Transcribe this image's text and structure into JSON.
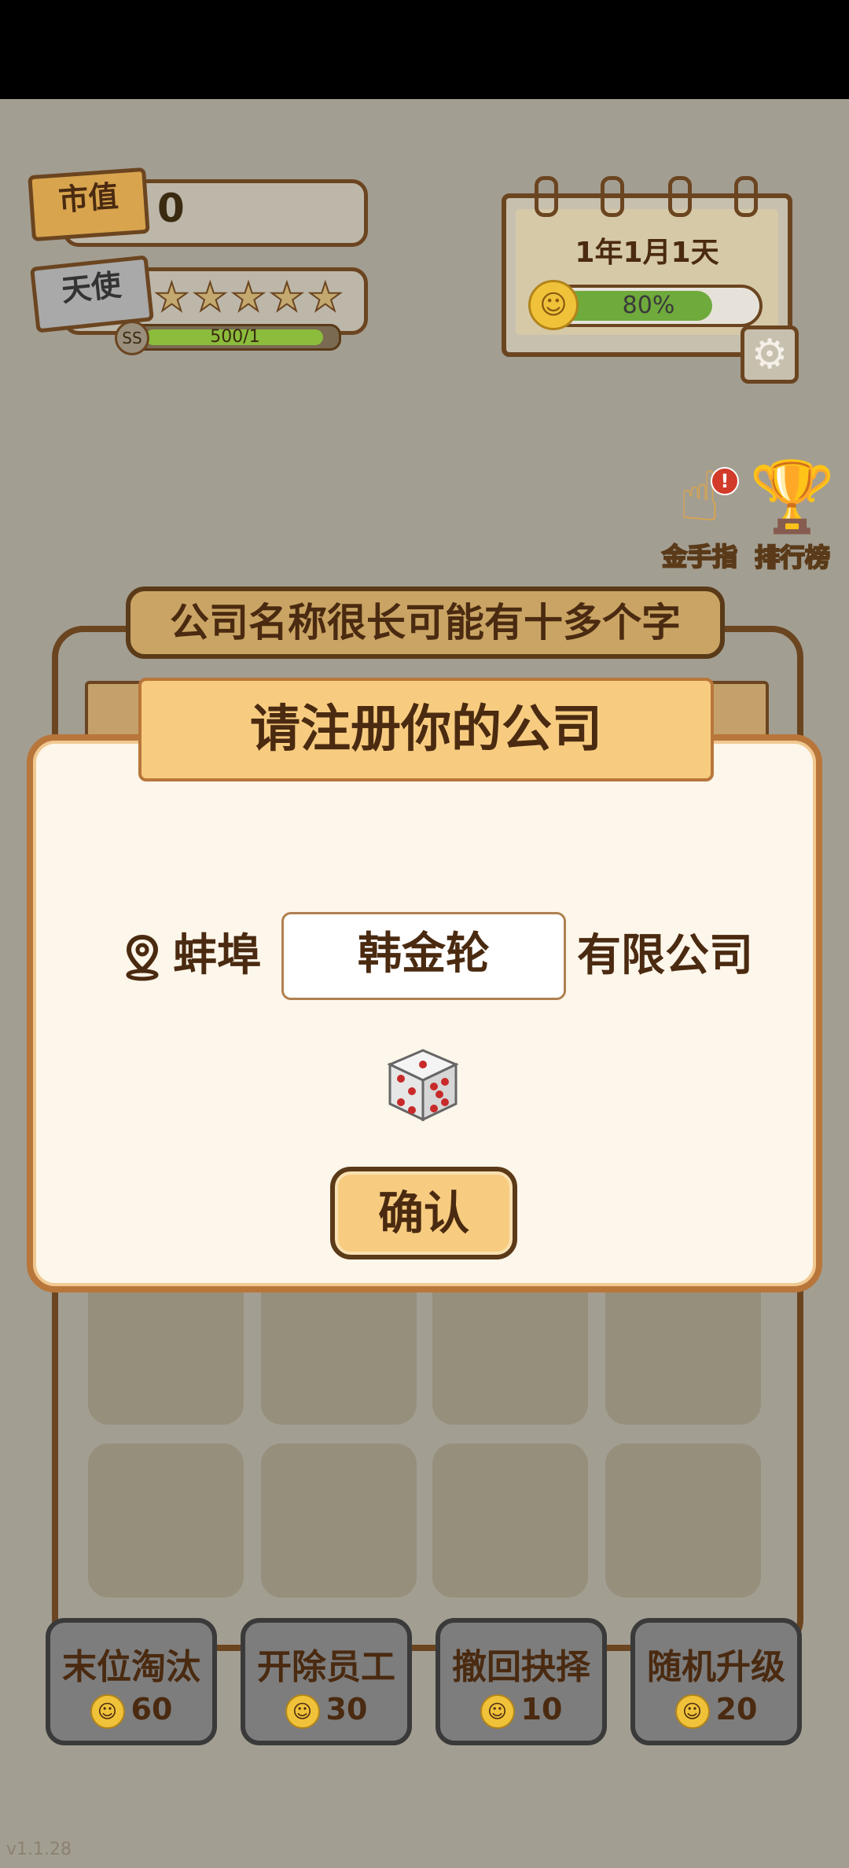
{
  "hud": {
    "market_value_label": "市值",
    "market_value": "0",
    "angel_label": "天使",
    "stars_total": 5,
    "level_badge": "SS",
    "exp_text": "500/1"
  },
  "calendar": {
    "date": "1年1月1天",
    "mood_progress": "80%",
    "mood_fraction": 0.8
  },
  "side": {
    "golden_finger": "金手指",
    "golden_finger_badge": "!",
    "leaderboard": "排行榜"
  },
  "company_title": "公司名称很长可能有十多个字",
  "dialog": {
    "title": "请注册你的公司",
    "city": "蚌埠",
    "name": "韩金轮",
    "suffix": "有限公司",
    "confirm": "确认"
  },
  "tools": [
    {
      "label": "末位淘汰",
      "cost": "60"
    },
    {
      "label": "开除员工",
      "cost": "30"
    },
    {
      "label": "撤回抉择",
      "cost": "10"
    },
    {
      "label": "随机升级",
      "cost": "20"
    }
  ],
  "version": "v1.1.28",
  "icons": [
    "location-pin-icon",
    "dice-icon",
    "gear-icon",
    "hand-icon",
    "trophy-icon",
    "smile-icon",
    "star-icon"
  ],
  "colors": {
    "accent": "#f7cc80",
    "border": "#6b4520",
    "background": "#a39e92"
  }
}
